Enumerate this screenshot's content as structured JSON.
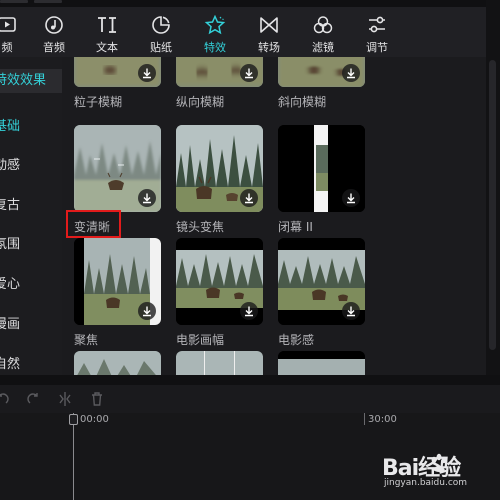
{
  "toolbar": {
    "items": [
      {
        "label": "频",
        "icon": "media-icon"
      },
      {
        "label": "音频",
        "icon": "audio-icon"
      },
      {
        "label": "文本",
        "icon": "text-icon"
      },
      {
        "label": "贴纸",
        "icon": "sticker-icon"
      },
      {
        "label": "特效",
        "icon": "effects-icon",
        "active": true
      },
      {
        "label": "转场",
        "icon": "transition-icon"
      },
      {
        "label": "滤镜",
        "icon": "filter-icon"
      },
      {
        "label": "调节",
        "icon": "adjust-icon"
      }
    ],
    "accent": "#33d0d8"
  },
  "sidebar": {
    "category": "特效效果",
    "items": [
      "基础",
      "动感",
      "复古",
      "氛围",
      "爱心",
      "漫画",
      "自然"
    ],
    "active_item": "基础"
  },
  "effects": {
    "top_row": [
      "粒子模糊",
      "纵向模糊",
      "斜向模糊"
    ],
    "middle_row": [
      "变清晰",
      "镜头变焦",
      "闭幕 II"
    ],
    "bottom_row": [
      "聚焦",
      "电影画幅",
      "电影感"
    ],
    "highlighted": "变清晰",
    "highlight_color": "#e21b1b",
    "download_icon": "download-icon"
  },
  "timeline": {
    "tools": [
      "undo-icon",
      "redo-icon",
      "split-icon",
      "delete-icon"
    ],
    "ruler_start": "00:00",
    "ruler_mark": "30:00"
  },
  "watermark": {
    "brand": "Bai经验",
    "url": "jingyan.baidu.com"
  }
}
